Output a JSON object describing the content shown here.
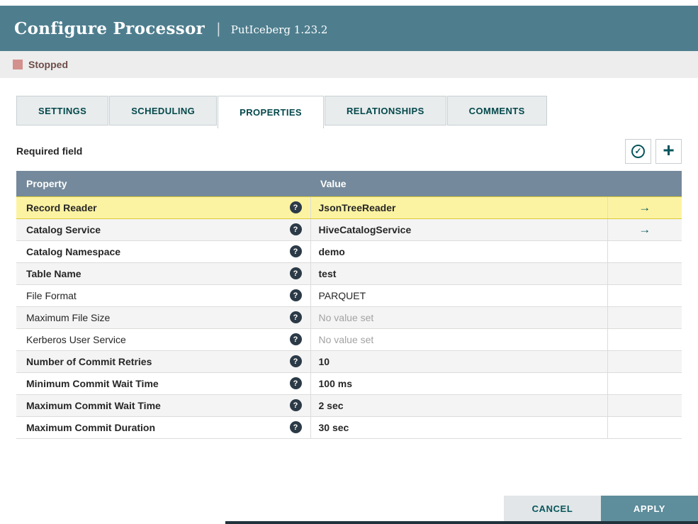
{
  "header": {
    "title": "Configure Processor",
    "separator": "|",
    "subtitle": "PutIceberg 1.23.2"
  },
  "status": {
    "label": "Stopped",
    "color": "#d3908c"
  },
  "tabs": [
    {
      "label": "SETTINGS",
      "active": false
    },
    {
      "label": "SCHEDULING",
      "active": false
    },
    {
      "label": "PROPERTIES",
      "active": true
    },
    {
      "label": "RELATIONSHIPS",
      "active": false
    },
    {
      "label": "COMMENTS",
      "active": false
    }
  ],
  "toolbar": {
    "required_label": "Required field"
  },
  "icons": {
    "help": "?",
    "goto": "→",
    "verify": "✓",
    "add": "+"
  },
  "table": {
    "columns": [
      "Property",
      "Value"
    ],
    "rows": [
      {
        "property": "Record Reader",
        "value": "JsonTreeReader",
        "required": true,
        "unset": false,
        "goto": true,
        "highlight": true
      },
      {
        "property": "Catalog Service",
        "value": "HiveCatalogService",
        "required": true,
        "unset": false,
        "goto": true,
        "highlight": false
      },
      {
        "property": "Catalog Namespace",
        "value": "demo",
        "required": true,
        "unset": false,
        "goto": false,
        "highlight": false
      },
      {
        "property": "Table Name",
        "value": "test",
        "required": true,
        "unset": false,
        "goto": false,
        "highlight": false
      },
      {
        "property": "File Format",
        "value": "PARQUET",
        "required": false,
        "unset": false,
        "goto": false,
        "highlight": false
      },
      {
        "property": "Maximum File Size",
        "value": "No value set",
        "required": false,
        "unset": true,
        "goto": false,
        "highlight": false
      },
      {
        "property": "Kerberos User Service",
        "value": "No value set",
        "required": false,
        "unset": true,
        "goto": false,
        "highlight": false
      },
      {
        "property": "Number of Commit Retries",
        "value": "10",
        "required": true,
        "unset": false,
        "goto": false,
        "highlight": false
      },
      {
        "property": "Minimum Commit Wait Time",
        "value": "100 ms",
        "required": true,
        "unset": false,
        "goto": false,
        "highlight": false
      },
      {
        "property": "Maximum Commit Wait Time",
        "value": "2 sec",
        "required": true,
        "unset": false,
        "goto": false,
        "highlight": false
      },
      {
        "property": "Maximum Commit Duration",
        "value": "30 sec",
        "required": true,
        "unset": false,
        "goto": false,
        "highlight": false
      }
    ]
  },
  "footer": {
    "cancel_label": "CANCEL",
    "apply_label": "APPLY"
  }
}
